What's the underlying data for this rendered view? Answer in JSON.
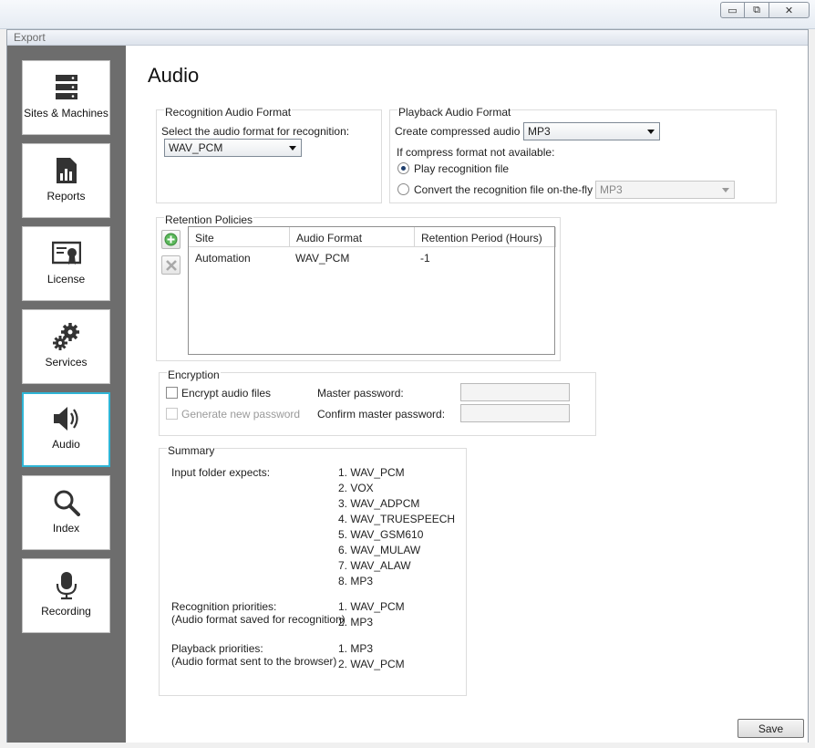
{
  "window": {
    "menu_label": "Export",
    "minimize": "▭",
    "restore": "⧉",
    "close": "✕"
  },
  "sidebar": {
    "items": [
      {
        "label": "Sites & Machines",
        "icon": "server-icon",
        "active": false
      },
      {
        "label": "Reports",
        "icon": "report-icon",
        "active": false
      },
      {
        "label": "License",
        "icon": "certificate-icon",
        "active": false
      },
      {
        "label": "Services",
        "icon": "gears-icon",
        "active": false
      },
      {
        "label": "Audio",
        "icon": "speaker-icon",
        "active": true
      },
      {
        "label": "Index",
        "icon": "magnifier-icon",
        "active": false
      },
      {
        "label": "Recording",
        "icon": "microphone-icon",
        "active": false
      }
    ]
  },
  "page": {
    "title": "Audio"
  },
  "recognition_format": {
    "legend": "Recognition Audio Format",
    "label": "Select the audio format for recognition:",
    "value": "WAV_PCM"
  },
  "playback_format": {
    "legend": "Playback Audio Format",
    "compressed_label": "Create compressed audio file:",
    "compressed_value": "MP3",
    "fallback_label": "If compress format not available:",
    "option_play": "Play recognition file",
    "option_convert": "Convert the recognition file on-the-fly to:",
    "convert_value": "MP3",
    "selected_option": "play"
  },
  "retention": {
    "legend": "Retention Policies",
    "columns": [
      "Site",
      "Audio Format",
      "Retention Period (Hours)"
    ],
    "rows": [
      {
        "site": "Automation",
        "format": "WAV_PCM",
        "period": "-1"
      }
    ]
  },
  "encryption": {
    "legend": "Encryption",
    "encrypt_label": "Encrypt audio files",
    "generate_label": "Generate new password",
    "master_label": "Master password:",
    "confirm_label": "Confirm master password:"
  },
  "summary": {
    "legend": "Summary",
    "input_label": "Input folder expects:",
    "input_list": [
      "1. WAV_PCM",
      "2. VOX",
      "3. WAV_ADPCM",
      "4. WAV_TRUESPEECH",
      "5. WAV_GSM610",
      "6. WAV_MULAW",
      "7. WAV_ALAW",
      "8. MP3"
    ],
    "recog_label": "Recognition priorities:",
    "recog_sub": "(Audio format saved for recognition)",
    "recog_list": [
      "1. WAV_PCM",
      "2. MP3"
    ],
    "playback_label": "Playback priorities:",
    "playback_sub": "(Audio format sent to the browser)",
    "playback_list": [
      "1. MP3",
      "2. WAV_PCM"
    ]
  },
  "footer": {
    "save_label": "Save"
  }
}
